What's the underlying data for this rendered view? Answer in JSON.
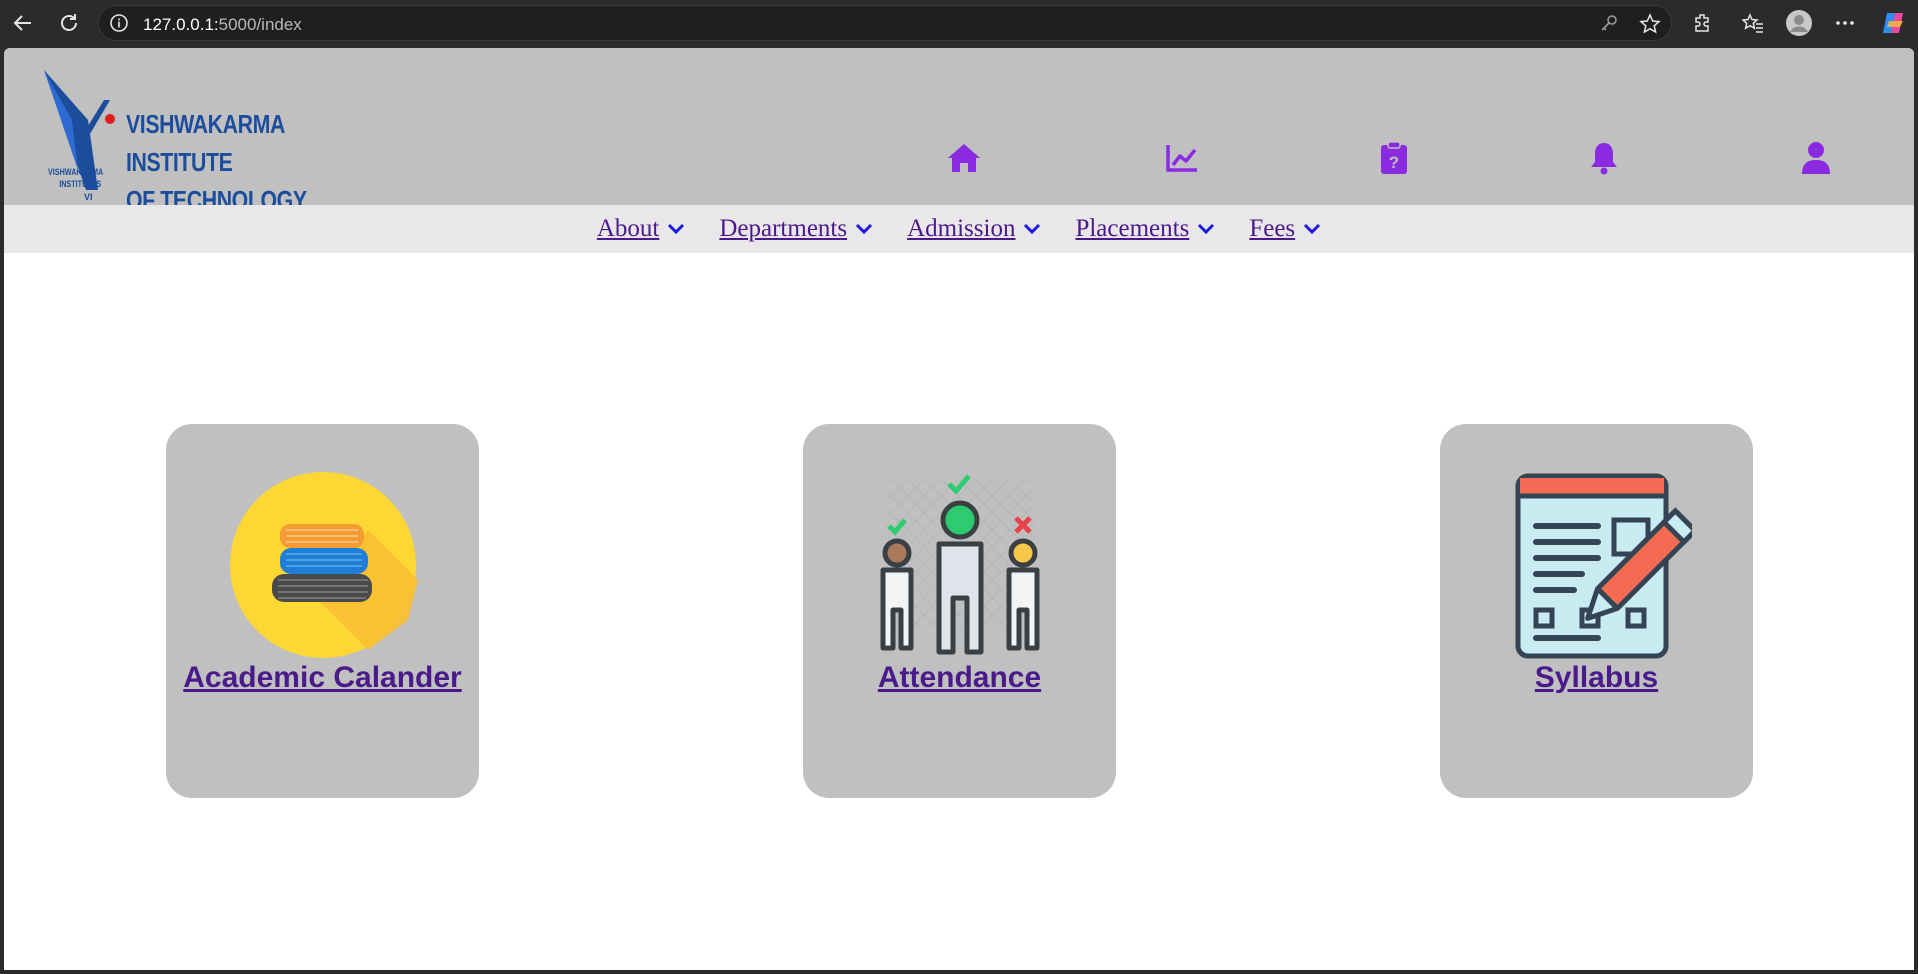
{
  "browser": {
    "url_host": "127.0.0.1:",
    "url_rest": "5000/index"
  },
  "header": {
    "logo_line1": "VISHWAKARMA INSTITUTE",
    "logo_line2": "OF TECHNOLOGY, PUNE",
    "logo_sub_line1": "VISHWAKARMA",
    "logo_sub_line2": "INSTITUTES",
    "icons": [
      "home-icon",
      "chart-line-icon",
      "clipboard-question-icon",
      "bell-icon",
      "user-icon"
    ],
    "icon_color": "#8a2be2",
    "bg_color": "#c0c0c0"
  },
  "nav": {
    "items": [
      {
        "label": "About"
      },
      {
        "label": "Departments"
      },
      {
        "label": "Admission"
      },
      {
        "label": "Placements"
      },
      {
        "label": "Fees"
      }
    ],
    "link_color": "#4b1a8a",
    "chevron_color": "#1a1ae0"
  },
  "cards": [
    {
      "label": "Academic Calander",
      "icon": "books-icon"
    },
    {
      "label": "Attendance",
      "icon": "attendance-people-icon"
    },
    {
      "label": "Syllabus",
      "icon": "syllabus-document-icon"
    }
  ]
}
